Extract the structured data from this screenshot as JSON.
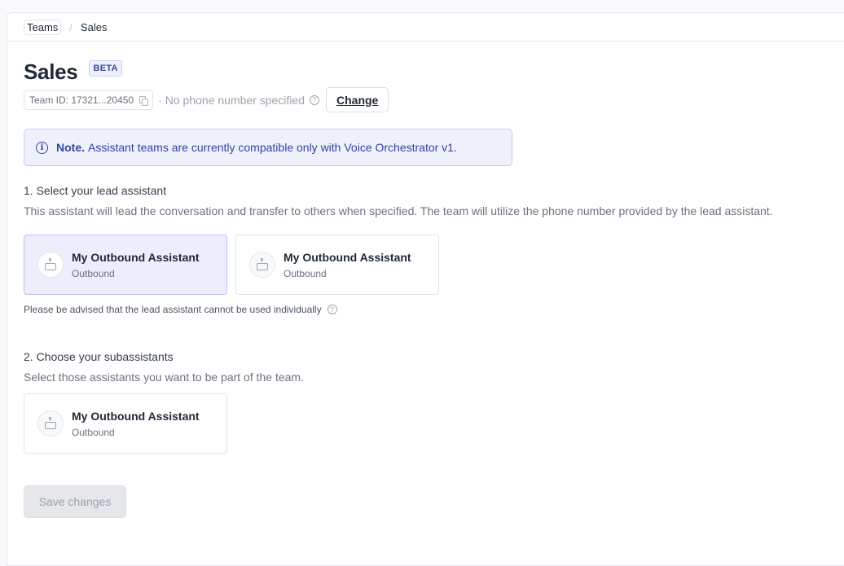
{
  "breadcrumb": {
    "parent": "Teams",
    "separator": "/",
    "current": "Sales"
  },
  "header": {
    "title": "Sales",
    "badge": "BETA",
    "team_id": "Team ID: 17321...20450",
    "separator": "·",
    "phone_status": "No phone number specified",
    "help_glyph": "?",
    "change_label": "Change"
  },
  "note": {
    "icon": "info-icon",
    "icon_glyph": "i",
    "strong": "Note.",
    "text": "Assistant teams are currently compatible only with Voice Orchestrator v1."
  },
  "lead": {
    "title": "1. Select your lead assistant",
    "description": "This assistant will lead the conversation and transfer to others when specified. The team will utilize the phone number provided by the lead assistant.",
    "assistants": [
      {
        "name": "My Outbound Assistant",
        "type": "Outbound",
        "selected": true
      },
      {
        "name": "My Outbound Assistant",
        "type": "Outbound",
        "selected": false
      }
    ],
    "advice": "Please be advised that the lead assistant cannot be used individually"
  },
  "sub": {
    "title": "2. Choose your subassistants",
    "description": "Select those assistants you want to be part of the team.",
    "assistants": [
      {
        "name": "My Outbound Assistant",
        "type": "Outbound",
        "selected": false
      }
    ]
  },
  "footer": {
    "save_label": "Save changes",
    "save_disabled": true
  },
  "colors": {
    "accent": "#3743a0",
    "selected_bg": "#eceefc",
    "note_bg": "#eef0fc"
  }
}
